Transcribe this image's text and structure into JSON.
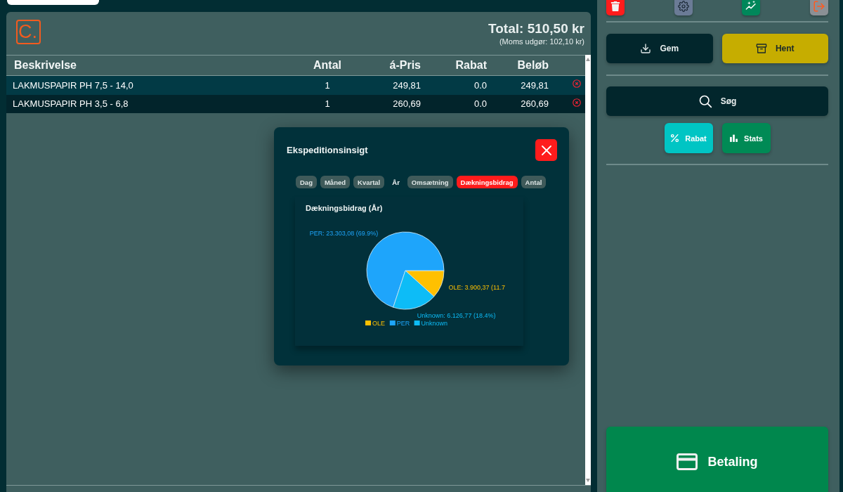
{
  "receipt": {
    "logo": "C.",
    "total": "Total: 510,50 kr",
    "vat_note": "(Moms udgør: 102,10 kr)"
  },
  "table": {
    "columns": [
      "Beskrivelse",
      "Antal",
      "á-Pris",
      "Rabat",
      "Beløb"
    ],
    "rows": [
      {
        "cells": [
          "LAKMUSPAPIR PH 7,5 - 14,0",
          "1",
          "249,81",
          "0.0",
          "249,81"
        ]
      },
      {
        "cells": [
          "LAKMUSPAPIR PH 3,5 - 6,8",
          "1",
          "260,69",
          "0.0",
          "260,69"
        ]
      }
    ]
  },
  "sidebar": {
    "save": "Gem",
    "load": "Hent",
    "search": "Søg",
    "discount": "Rabat",
    "stats": "Stats",
    "payment": "Betaling"
  },
  "dialog": {
    "title": "Ekspeditionsinsigt",
    "periods": [
      {
        "label": "Dag",
        "selected": false
      },
      {
        "label": "Måned",
        "selected": false
      },
      {
        "label": "Kvartal",
        "selected": false
      },
      {
        "label": "År",
        "selected": true
      }
    ],
    "metrics": [
      {
        "label": "Omsætning",
        "selected": false
      },
      {
        "label": "Dækningsbidrag",
        "selected": true
      },
      {
        "label": "Antal",
        "selected": false
      }
    ],
    "chart_data": {
      "type": "pie",
      "title": "Dækningsbidrag (År)",
      "categories": [
        "OLE",
        "PER",
        "Unknown"
      ],
      "values": [
        3900.37,
        23303.08,
        6126.77
      ],
      "colors": [
        "#ffc000",
        "#1ea5fb",
        "#0dbcf7"
      ],
      "value_labels": [
        "OLE: 3.900,37 (11.7",
        "PER: 23.303,08 (69.9%)",
        "Unknown: 6.126,77 (18.4%)"
      ],
      "legend": "bottom"
    }
  }
}
